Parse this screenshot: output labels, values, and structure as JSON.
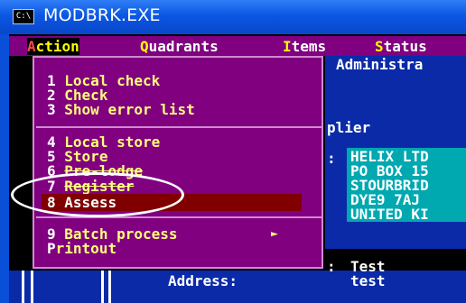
{
  "window": {
    "title": "MODBRK.EXE",
    "icon": "console-icon",
    "icon_text": "C:\\"
  },
  "menubar": {
    "items": [
      {
        "hotkey": "A",
        "rest": "ction"
      },
      {
        "hotkey": "Q",
        "rest": "uadrants"
      },
      {
        "hotkey": "I",
        "rest": "tems"
      },
      {
        "hotkey": "S",
        "rest": "tatus"
      }
    ]
  },
  "dropdown": {
    "groups": [
      [
        {
          "num": "1",
          "label": "Local check"
        },
        {
          "num": "2",
          "label": "Check"
        },
        {
          "num": "3",
          "label": "Show error list"
        }
      ],
      [
        {
          "num": "4",
          "label": "Local store"
        },
        {
          "num": "5",
          "label": "Store"
        },
        {
          "num": "6",
          "label": "Pre-lodge"
        },
        {
          "num": "7",
          "label": "Register"
        },
        {
          "num": "8",
          "label": "Assess"
        }
      ],
      [
        {
          "num": "9",
          "label": "Batch process",
          "submenu": "►"
        },
        {
          "num": "P",
          "label": "rintout"
        }
      ]
    ],
    "selected": "8"
  },
  "background": {
    "panel_title": "Administra",
    "supplier_label": "plier",
    "supplier_colon": ":",
    "supplier_lines": [
      "HELIX LTD",
      "PO BOX 15",
      "STOURBRID",
      "DYE9 7AJ",
      "UNITED KI"
    ],
    "address_label": "Address:",
    "address_colon": ":",
    "address_lines": [
      "Test",
      "test"
    ]
  },
  "colors": {
    "menu_bg": "#800080",
    "selection": "#800000",
    "titlebar": "#0b57e3",
    "panel": "#0a2aa8",
    "cyan": "#00a8b0"
  }
}
